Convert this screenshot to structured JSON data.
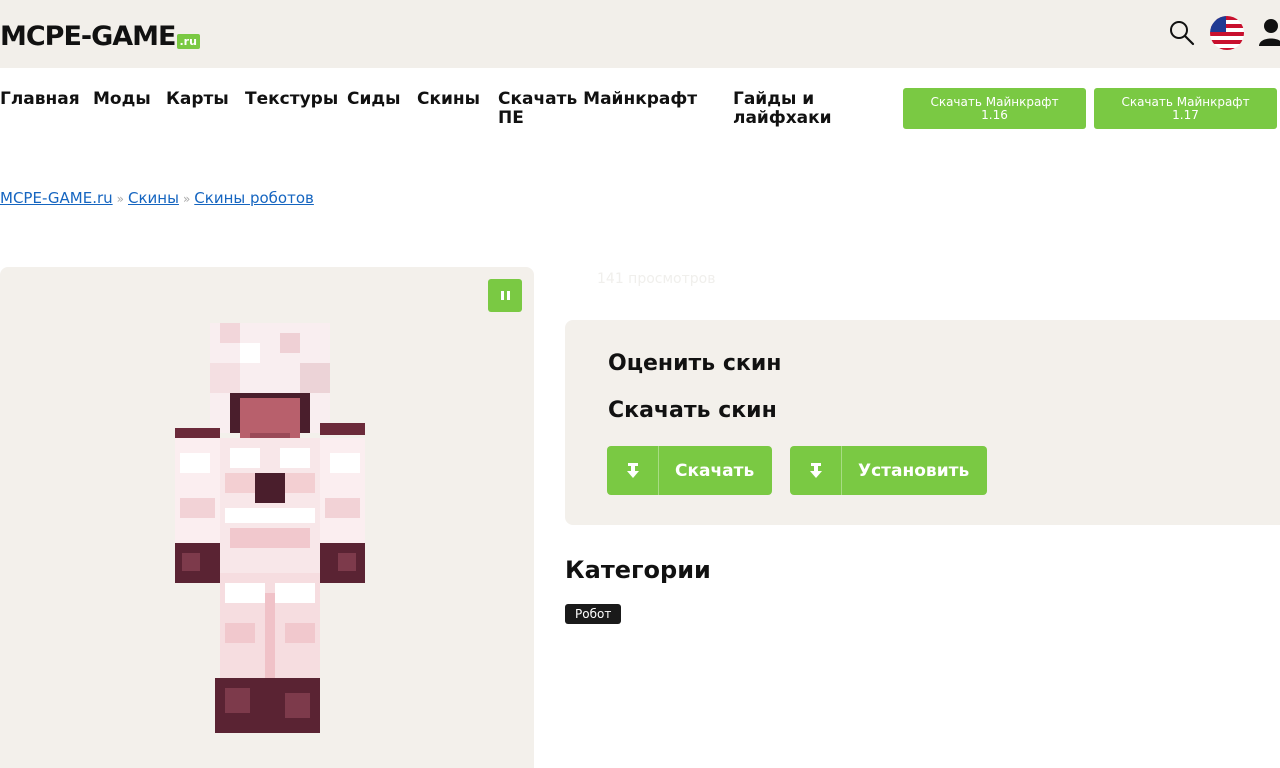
{
  "header": {
    "logo_text": "MCPE-GAME",
    "logo_suffix": ".ru"
  },
  "icons": {
    "search": "search-icon",
    "language": "us-flag-icon",
    "user": "user-icon",
    "pause": "pause-icon",
    "download": "download-icon"
  },
  "nav": {
    "items": [
      "Главная",
      "Моды",
      "Карты",
      "Текстуры",
      "Сиды",
      "Скины",
      "Скачать Майнкрафт ПЕ",
      "Гайды и лайфхаки"
    ],
    "download_buttons": [
      {
        "line1": "Скачать Майнкрафт",
        "line2": "1.16"
      },
      {
        "line1": "Скачать Майнкрафт",
        "line2": "1.17"
      }
    ]
  },
  "breadcrumb": {
    "items": [
      "MCPE-GAME.ru",
      "Скины",
      "Скины роботов"
    ],
    "separator": "»"
  },
  "skin": {
    "views": "141 просмотров",
    "rate_title": "Оценить скин",
    "download_title": "Скачать скин",
    "download_button": "Скачать",
    "install_button": "Установить"
  },
  "categories": {
    "title": "Категории",
    "tags": [
      "Робот"
    ]
  },
  "colors": {
    "accent": "#7ac943",
    "link": "#1565c0",
    "panel": "#f3f0eb",
    "header_bg": "#f2efea"
  }
}
